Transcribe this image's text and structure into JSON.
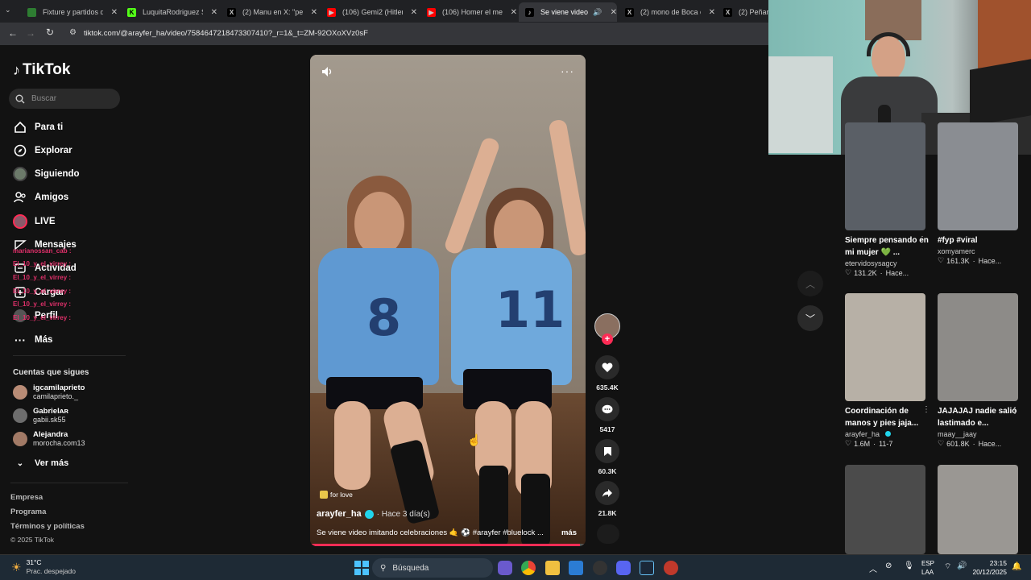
{
  "browser": {
    "tabs": [
      {
        "title": "Fixture y partidos de",
        "favicon_color": "#2e7d32",
        "active": false
      },
      {
        "title": "LuquitaRodriguez Str",
        "favicon_color": "#53fc18",
        "active": false
      },
      {
        "title": "(2) Manu en X: \"perd",
        "favicon_color": "#000000",
        "active": false
      },
      {
        "title": "(106) Gemi2 (Hitler M",
        "favicon_color": "#ff0000",
        "active": false
      },
      {
        "title": "(106) Homer el merc",
        "favicon_color": "#ff0000",
        "active": false
      },
      {
        "title": "Se viene video im",
        "favicon_color": "#000000",
        "active": true
      },
      {
        "title": "(2) mono de Boca en",
        "favicon_color": "#000000",
        "active": false
      },
      {
        "title": "(2) Peñargro",
        "favicon_color": "#000000",
        "active": false
      }
    ],
    "url": "tiktok.com/@arayfer_ha/video/7584647218473307410?_r=1&_t=ZM-92OXoXVz0sF"
  },
  "sidebar": {
    "logo": "TikTok",
    "search_placeholder": "Buscar",
    "nav": [
      {
        "label": "Para ti",
        "icon": "home-icon"
      },
      {
        "label": "Explorar",
        "icon": "compass-icon"
      },
      {
        "label": "Siguiendo",
        "icon": "following-avatar-icon"
      },
      {
        "label": "Amigos",
        "icon": "friends-icon"
      },
      {
        "label": "LIVE",
        "icon": "live-icon"
      },
      {
        "label": "Mensajes",
        "icon": "messages-icon"
      },
      {
        "label": "Actividad",
        "icon": "activity-icon"
      },
      {
        "label": "Cargar",
        "icon": "upload-icon"
      },
      {
        "label": "Perfil",
        "icon": "profile-icon"
      },
      {
        "label": "Más",
        "icon": "more-icon"
      }
    ],
    "following_title": "Cuentas que sigues",
    "following": [
      {
        "name": "igcamilaprieto",
        "handle": "camilaprieto._"
      },
      {
        "name": "Gabrielᴀʀ",
        "handle": "gabii.sk55"
      },
      {
        "name": "Alejandra",
        "handle": "morocha.com13"
      }
    ],
    "see_more": "Ver más",
    "footer": [
      "Empresa",
      "Programa",
      "Términos y políticas",
      "© 2025 TikTok"
    ],
    "chat_overlay": [
      "marianossan_cab :",
      "El_10_y_el_virrey :",
      "El_10_y_el_virrey :",
      "El_10_y_el_virrey :",
      "El_10_y_el_virrey :",
      "El_10_y_el_virrey :"
    ]
  },
  "video": {
    "music_tag": "for love",
    "author": "arayfer_ha",
    "time": "· Hace 3 día(s)",
    "description": "Se viene video imitando celebraciones 🤙 ⚽ #arayfer #bluelock ...",
    "more": "más",
    "jersey_numbers": [
      "8",
      "11"
    ],
    "progress": 0.98
  },
  "actions": {
    "likes": "635.4K",
    "comments": "5417",
    "saves": "60.3K",
    "shares": "21.8K"
  },
  "recommendations": [
    {
      "title": "Siempre pensando en mi mujer 💚 ...",
      "account": "etervidosysagcy",
      "likes": "131.2K",
      "time": "Hace...",
      "thumb": "#5a5f66"
    },
    {
      "title": "#fyp #viral",
      "account": "xomyamerc",
      "likes": "161.3K",
      "time": "Hace...",
      "thumb": "#8a8d92"
    },
    {
      "title": "Coordinación de manos y pies jaja...",
      "account": "arayfer_ha",
      "likes": "1.6M",
      "time": "11-7",
      "thumb": "#b7b0a6"
    },
    {
      "title": "JAJAJAJ nadie salió lastimado e...",
      "account": "maay__jaay",
      "likes": "601.8K",
      "time": "Hace...",
      "thumb": "#8d8b88"
    },
    {
      "title": "",
      "account": "",
      "likes": "",
      "time": "",
      "thumb": "#4b4b4b"
    },
    {
      "title": "",
      "account": "",
      "likes": "",
      "time": "",
      "thumb": "#9a9793"
    }
  ],
  "taskbar": {
    "weather_temp": "31°C",
    "weather_desc": "Prac. despejado",
    "search_placeholder": "Búsqueda",
    "lang1": "ESP",
    "lang2": "LAA",
    "time": "23:15",
    "date": "20/12/2025"
  },
  "colors": {
    "accent": "#fe2c55",
    "verified": "#20d5ec",
    "bg": "#121212"
  }
}
